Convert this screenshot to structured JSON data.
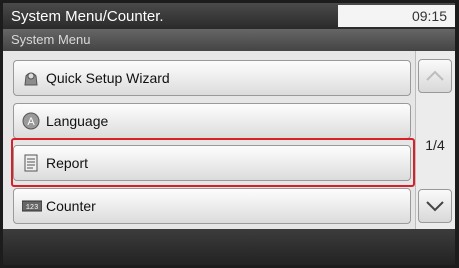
{
  "header": {
    "title": "System Menu/Counter.",
    "time": "09:15",
    "subtitle": "System Menu"
  },
  "menu": {
    "items": [
      {
        "label": "Quick Setup Wizard",
        "icon": "wizard-icon"
      },
      {
        "label": "Language",
        "icon": "language-icon"
      },
      {
        "label": "Report",
        "icon": "report-icon",
        "highlighted": true
      },
      {
        "label": "Counter",
        "icon": "counter-icon"
      }
    ]
  },
  "pagination": {
    "page": "1/4"
  },
  "colors": {
    "highlight": "#d8202a"
  }
}
